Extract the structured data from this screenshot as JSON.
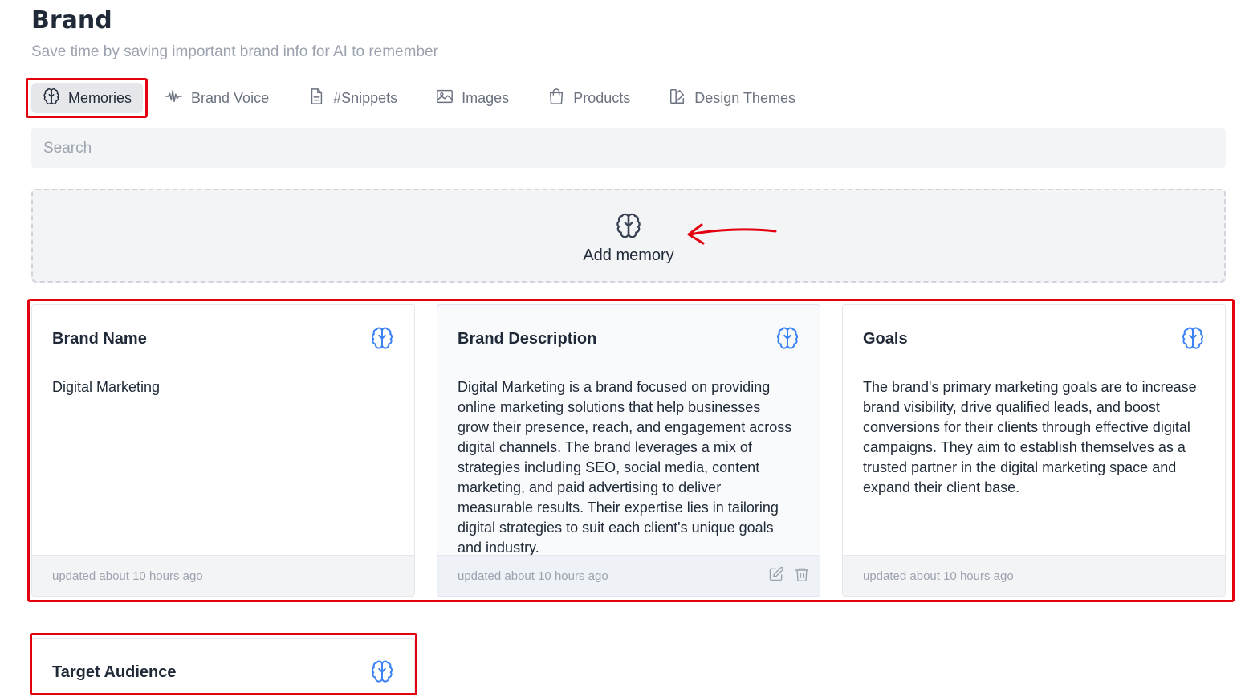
{
  "header": {
    "title": "Brand",
    "subtitle": "Save time by saving important brand info for AI to remember"
  },
  "tabs": [
    {
      "label": "Memories",
      "icon": "brain-icon",
      "active": true
    },
    {
      "label": "Brand Voice",
      "icon": "waveform-icon",
      "active": false
    },
    {
      "label": "#Snippets",
      "icon": "document-icon",
      "active": false
    },
    {
      "label": "Images",
      "icon": "image-icon",
      "active": false
    },
    {
      "label": "Products",
      "icon": "shopping-bag-icon",
      "active": false
    },
    {
      "label": "Design Themes",
      "icon": "swatch-icon",
      "active": false
    }
  ],
  "search": {
    "placeholder": "Search",
    "value": ""
  },
  "add_memory": {
    "label": "Add memory",
    "icon": "brain-icon"
  },
  "memories": [
    {
      "title": "Brand Name",
      "body": "Digital Marketing",
      "updated": "updated about 10 hours ago"
    },
    {
      "title": "Brand Description",
      "body": "Digital Marketing is a brand focused on providing online marketing solutions that help businesses grow their presence, reach, and engagement across digital channels. The brand leverages a mix of strategies including SEO, social media, content marketing, and paid advertising to deliver measurable results. Their expertise lies in tailoring digital strategies to suit each client's unique goals and industry.",
      "updated": "updated about 10 hours ago",
      "actions": [
        "edit-icon",
        "trash-icon"
      ]
    },
    {
      "title": "Goals",
      "body": "The brand's primary marketing goals are to increase brand visibility, drive qualified leads, and boost conversions for their clients through effective digital campaigns. They aim to establish themselves as a trusted partner in the digital marketing space and expand their client base.",
      "updated": "updated about 10 hours ago"
    },
    {
      "title": "Target Audience"
    }
  ],
  "colors": {
    "accent": "#3b82f6",
    "annotation": "#e3000f"
  }
}
